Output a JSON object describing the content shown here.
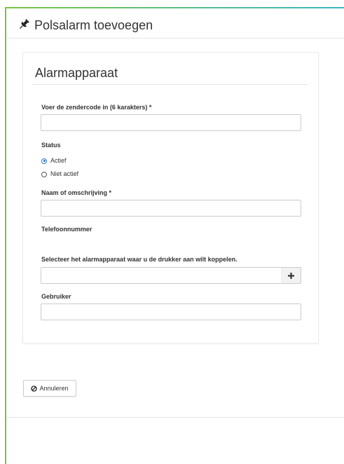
{
  "page": {
    "title": "Polsalarm toevoegen",
    "title_icon": "pushpin-icon"
  },
  "form": {
    "section_title": "Alarmapparaat",
    "sender_code": {
      "label": "Voer de zendercode in (6 karakters) *",
      "value": ""
    },
    "status": {
      "label": "Status",
      "options": [
        {
          "label": "Actief",
          "checked": true
        },
        {
          "label": "Niet actief",
          "checked": false
        }
      ]
    },
    "name": {
      "label": "Naam of omschrijving *",
      "value": ""
    },
    "phone": {
      "label": "Telefoonnummer"
    },
    "device_select": {
      "label": "Selecteer het alarmapparaat waar u de drukker aan wilt koppelen.",
      "value": "",
      "add_icon": "plus-icon"
    },
    "user": {
      "label": "Gebruiker",
      "value": ""
    }
  },
  "actions": {
    "cancel_label": "Annuleren",
    "cancel_icon": "ban-icon"
  },
  "colors": {
    "accent_green": "#7cc342",
    "accent_teal": "#3bb8c4",
    "radio_blue": "#2b77d6"
  }
}
